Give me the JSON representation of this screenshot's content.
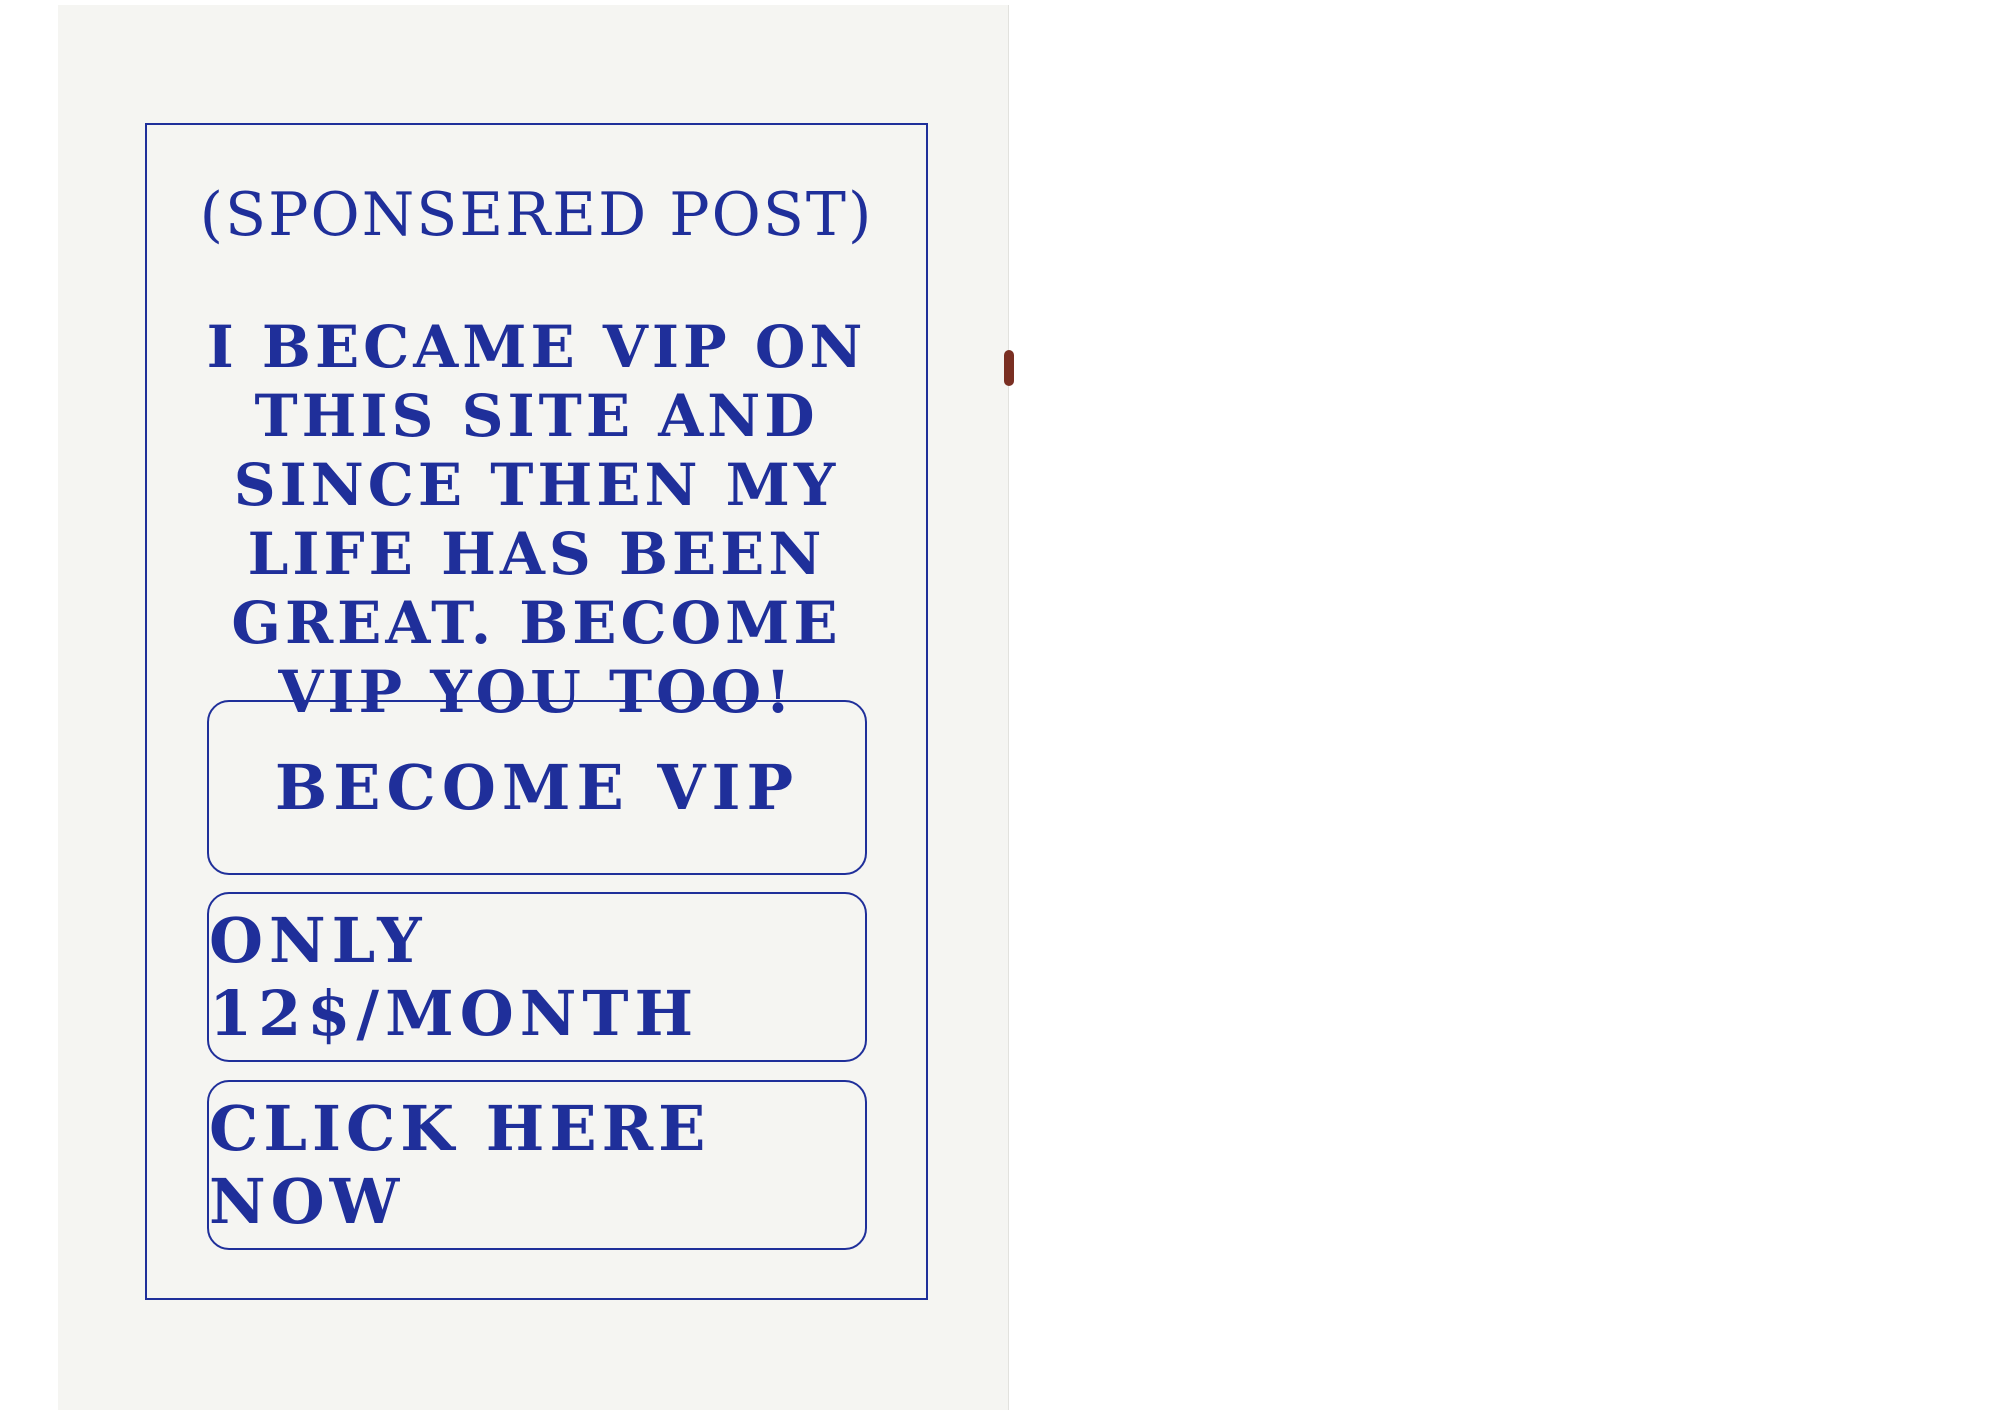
{
  "ad": {
    "subtitle": "(sponsered post)",
    "message": "I BECAME VIP ON THIS SITE AND SINCE THEN MY LIFE HAS BEEN GREAT. BECOME VIP YOU TOO!",
    "buttons": [
      {
        "label": "Become VIP"
      },
      {
        "label": "ONLY 12$/MONTH"
      },
      {
        "label": "CLICK HERE NOW"
      }
    ]
  },
  "colors": {
    "ink": "#1f2f9a",
    "paper": "#f5f5f2",
    "background": "#ffffff"
  }
}
